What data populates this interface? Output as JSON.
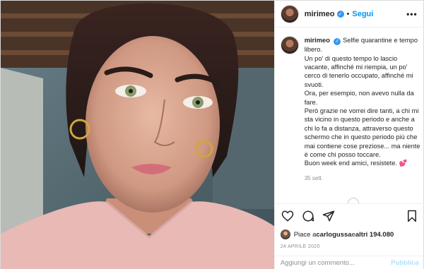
{
  "post": {
    "username": "mirimeo",
    "verified_icon": "verified-badge-icon",
    "dot": "•",
    "follow_label": "Segui",
    "more_label": "•••"
  },
  "caption": {
    "username": "mirimeo",
    "lines": [
      "Selfie quarantine e tempo libero.",
      "Un po' di questo tempo lo lascio vacante, affinché mi riempia, un po' cerco di tenerlo occupato, affinché mi svuoti.",
      "Ora, per esempio, non avevo nulla da fare.",
      "Però grazie ne vorrei dire tanti, a chi mi sta vicino in questo periodo e anche a chi lo fa a distanza, attraverso questo schermo che in questo periodo più che mai contiene cose preziose... ma niente è come chi posso toccare.",
      "Buon week end amici, resistete."
    ],
    "emoji": "💕",
    "time": "35 sett."
  },
  "actions": {
    "like_icon": "heart-icon",
    "comment_icon": "comment-icon",
    "share_icon": "share-icon",
    "save_icon": "bookmark-icon"
  },
  "likes": {
    "prefix": "Piace a ",
    "user": "carlogussa",
    "middle": " e ",
    "others": "altri 194.080"
  },
  "date": "24 APRILE 2020",
  "comment": {
    "placeholder": "Aggiungi un commento...",
    "publish_label": "Pubblica"
  },
  "colors": {
    "accent": "#0095f6",
    "verified": "#3897f0",
    "muted": "#8e8e8e",
    "publish_disabled": "#b2dffc"
  }
}
